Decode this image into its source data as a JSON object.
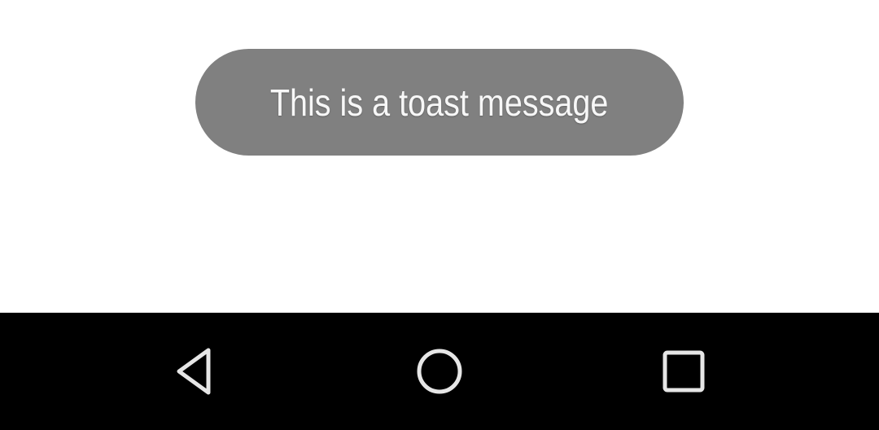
{
  "toast": {
    "message": "This is a toast message",
    "background": "#808080",
    "text_color": "#f7f7f7"
  },
  "navigation_bar": {
    "background": "#000000",
    "icon_color": "#e6e6e6",
    "buttons": [
      {
        "name": "back",
        "icon": "back-triangle-icon"
      },
      {
        "name": "home",
        "icon": "home-circle-icon"
      },
      {
        "name": "recents",
        "icon": "recents-square-icon"
      }
    ]
  }
}
